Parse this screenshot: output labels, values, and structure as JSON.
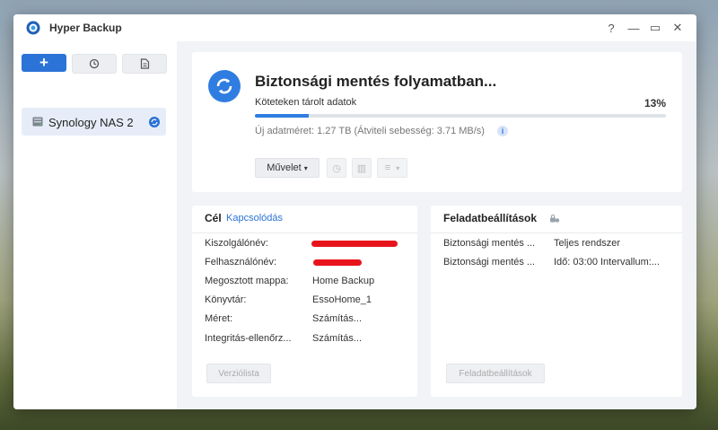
{
  "window": {
    "title": "Hyper Backup",
    "help": "?",
    "minimize": "—",
    "maximize": "▭",
    "close": "✕"
  },
  "sidebar": {
    "add_label": "+",
    "restore_icon": "history-icon",
    "log_icon": "log-icon",
    "tasks": [
      {
        "label": "Synology NAS 2"
      }
    ]
  },
  "status": {
    "title": "Biztonsági mentés folyamatban...",
    "sub_label": "Köteteken tárolt adatok",
    "percent": "13%",
    "progress": 0.13,
    "detail": "Új adatméret: 1.27 TB (Átviteli sebesség: 3.71 MB/s)",
    "info": "i",
    "action_label": "Művelet"
  },
  "target_card": {
    "title": "Cél",
    "link": "Kapcsolódás",
    "rows": [
      {
        "label": "Kiszolgálónév:",
        "value": ""
      },
      {
        "label": "Felhasználónév:",
        "value": ""
      },
      {
        "label": "Megosztott mappa:",
        "value": "Home Backup"
      },
      {
        "label": "Könyvtár:",
        "value": "EssoHome_1"
      },
      {
        "label": "Méret:",
        "value": "Számítás..."
      },
      {
        "label": "Integritás-ellenőrz...",
        "value": "Számítás..."
      }
    ],
    "button": "Verziólista"
  },
  "settings_card": {
    "title": "Feladatbeállítások",
    "rows": [
      {
        "label": "Biztonsági mentés ...",
        "value": "Teljes rendszer"
      },
      {
        "label": "Biztonsági mentés ...",
        "value": "Idő: 03:00 Intervallum:..."
      }
    ],
    "button": "Feladatbeállítások"
  },
  "colors": {
    "accent": "#2b73d6",
    "progress": "#2f7de1",
    "redaction": "#e8141c"
  }
}
